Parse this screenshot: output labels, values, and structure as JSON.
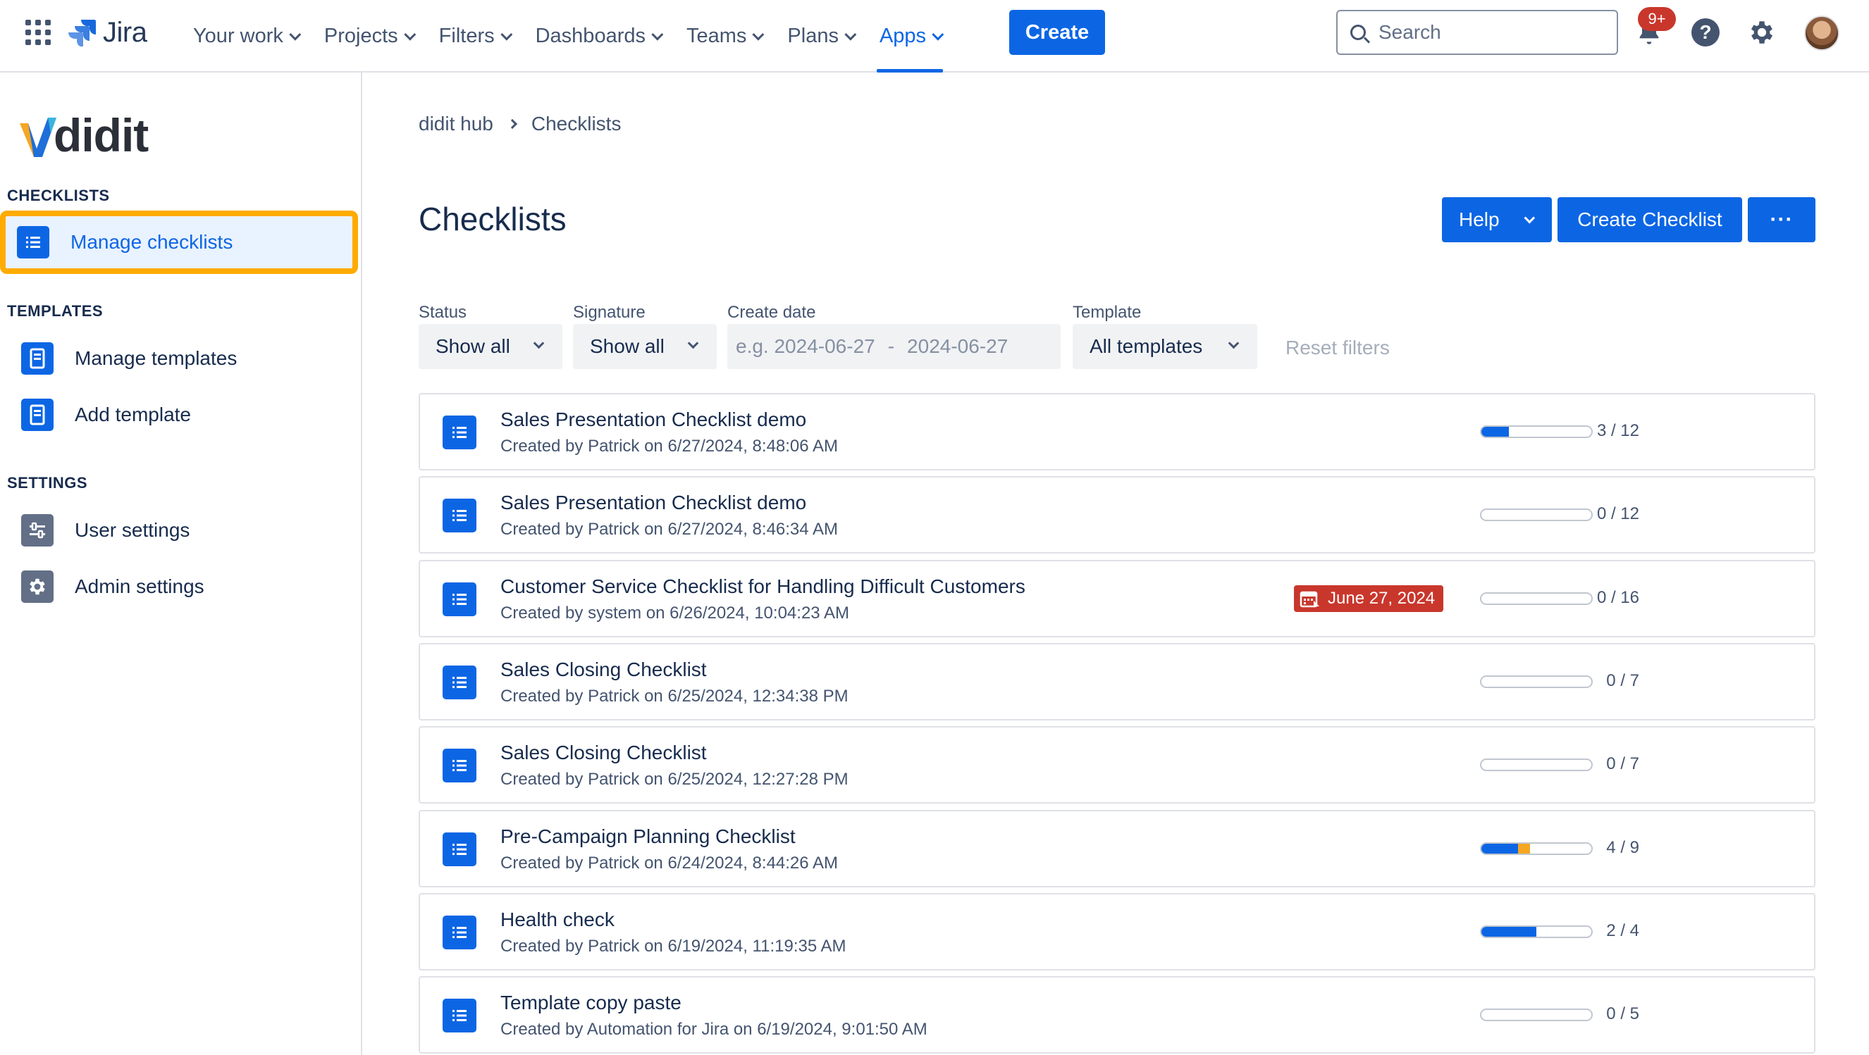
{
  "topnav": {
    "logo_text": "Jira",
    "items": [
      {
        "label": "Your work"
      },
      {
        "label": "Projects"
      },
      {
        "label": "Filters"
      },
      {
        "label": "Dashboards"
      },
      {
        "label": "Teams"
      },
      {
        "label": "Plans"
      },
      {
        "label": "Apps",
        "active": true
      }
    ],
    "create_label": "Create",
    "search_placeholder": "Search",
    "notifications_badge": "9+",
    "help_glyph": "?"
  },
  "sidebar": {
    "logo_text": "didit",
    "sections": {
      "checklists": "CHECKLISTS",
      "templates": "TEMPLATES",
      "settings": "SETTINGS"
    },
    "items": {
      "manage_checklists": "Manage checklists",
      "manage_templates": "Manage templates",
      "add_template": "Add template",
      "user_settings": "User settings",
      "admin_settings": "Admin settings"
    }
  },
  "main": {
    "breadcrumb": [
      "didit hub",
      "Checklists"
    ],
    "title": "Checklists",
    "buttons": {
      "help": "Help",
      "create_checklist": "Create Checklist",
      "more": "···"
    },
    "filters": {
      "status": {
        "label": "Status",
        "value": "Show all"
      },
      "signature": {
        "label": "Signature",
        "value": "Show all"
      },
      "create_date": {
        "label": "Create date",
        "from": "e.g. 2024-06-27",
        "separator": "-",
        "to": "2024-06-27"
      },
      "template": {
        "label": "Template",
        "value": "All templates"
      },
      "reset": "Reset filters"
    },
    "checklists": [
      {
        "title": "Sales Presentation Checklist demo",
        "subtitle": "Created by Patrick on 6/27/2024, 8:48:06 AM",
        "count": "3 / 12",
        "done": 3,
        "partial": 0,
        "total": 12
      },
      {
        "title": "Sales Presentation Checklist demo",
        "subtitle": "Created by Patrick on 6/27/2024, 8:46:34 AM",
        "count": "0 / 12",
        "done": 0,
        "partial": 0,
        "total": 12
      },
      {
        "title": "Customer Service Checklist for Handling Difficult Customers",
        "subtitle": "Created by system on 6/26/2024, 10:04:23 AM",
        "count": "0 / 16",
        "done": 0,
        "partial": 0,
        "total": 16,
        "due": "June 27, 2024"
      },
      {
        "title": "Sales Closing Checklist",
        "subtitle": "Created by Patrick on 6/25/2024, 12:34:38 PM",
        "count": "0 / 7",
        "done": 0,
        "partial": 0,
        "total": 7
      },
      {
        "title": "Sales Closing Checklist",
        "subtitle": "Created by Patrick on 6/25/2024, 12:27:28 PM",
        "count": "0 / 7",
        "done": 0,
        "partial": 0,
        "total": 7
      },
      {
        "title": "Pre-Campaign Planning Checklist",
        "subtitle": "Created by Patrick on 6/24/2024, 8:44:26 AM",
        "count": "4 / 9",
        "done": 3,
        "partial": 1,
        "total": 9
      },
      {
        "title": "Health check",
        "subtitle": "Created by Patrick on 6/19/2024, 11:19:35 AM",
        "count": "2 / 4",
        "done": 2,
        "partial": 0,
        "total": 4
      },
      {
        "title": "Template copy paste",
        "subtitle": "Created by Automation for Jira on 6/19/2024, 9:01:50 AM",
        "count": "0 / 5",
        "done": 0,
        "partial": 0,
        "total": 5
      }
    ]
  },
  "colors": {
    "accent": "#0c66e4",
    "highlight": "#ffab00",
    "due_badge": "#c9372c",
    "partial_progress": "#f5a623"
  }
}
